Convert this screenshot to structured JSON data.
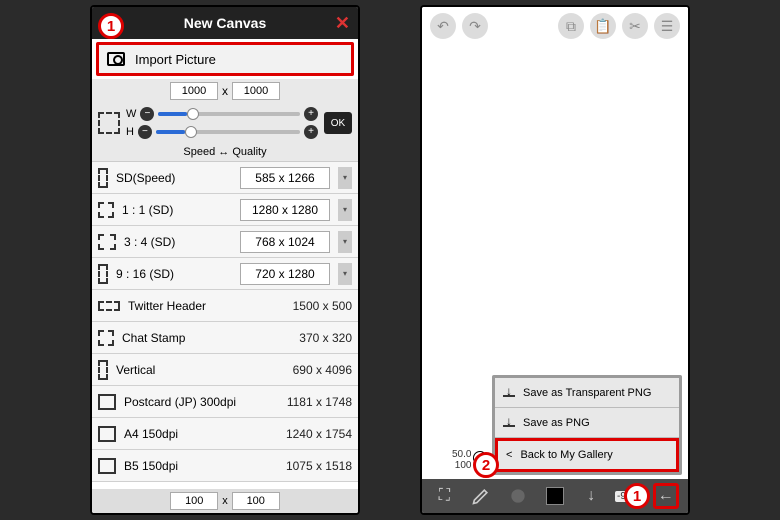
{
  "left": {
    "title": "New Canvas",
    "import_label": "Import Picture",
    "top_w": "1000",
    "top_h": "1000",
    "ok": "OK",
    "w_label": "W",
    "h_label": "H",
    "speed_quality": "Speed ↔ Quality",
    "presets_editable": [
      {
        "name": "SD(Speed)",
        "size": "585 x 1266"
      },
      {
        "name": "1 : 1 (SD)",
        "size": "1280 x 1280"
      },
      {
        "name": "3 : 4 (SD)",
        "size": "768 x 1024"
      },
      {
        "name": "9 : 16 (SD)",
        "size": "720 x 1280"
      }
    ],
    "presets_static": [
      {
        "name": "Twitter Header",
        "size": "1500 x 500",
        "shape": "wide"
      },
      {
        "name": "Chat Stamp",
        "size": "370 x 320",
        "shape": "sq"
      },
      {
        "name": "Vertical",
        "size": "690 x 4096",
        "shape": "tall"
      },
      {
        "name": "Postcard (JP) 300dpi",
        "size": "1181 x 1748",
        "shape": "solid"
      },
      {
        "name": "A4 150dpi",
        "size": "1240 x 1754",
        "shape": "solid"
      },
      {
        "name": "B5 150dpi",
        "size": "1075 x 1518",
        "shape": "solid"
      }
    ],
    "footer_w": "100",
    "footer_h": "100",
    "x": "x"
  },
  "right": {
    "brush_size": "50.0",
    "brush_opacity": "100",
    "angle": "-90.0",
    "menu": {
      "save_transparent": "Save as Transparent PNG",
      "save_png": "Save as PNG",
      "back_gallery": "Back to My Gallery"
    }
  },
  "callouts": {
    "c1": "1",
    "c2": "2"
  }
}
